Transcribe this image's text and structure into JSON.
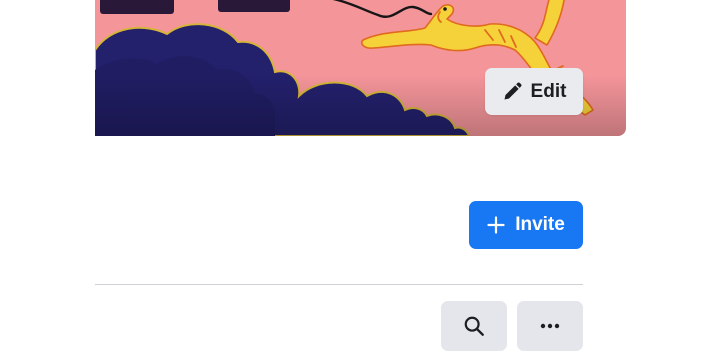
{
  "cover": {
    "edit_label": "Edit"
  },
  "actions": {
    "invite_label": "Invite"
  },
  "toolbar": {
    "search_icon": "search-icon",
    "more_icon": "more-horizontal-icon"
  },
  "colors": {
    "primary_blue": "#1877f2",
    "secondary_button": "#e4e6eb",
    "cover_pink": "#f4959a",
    "cover_navy": "#23206c",
    "cover_yellow": "#f5d23a"
  }
}
